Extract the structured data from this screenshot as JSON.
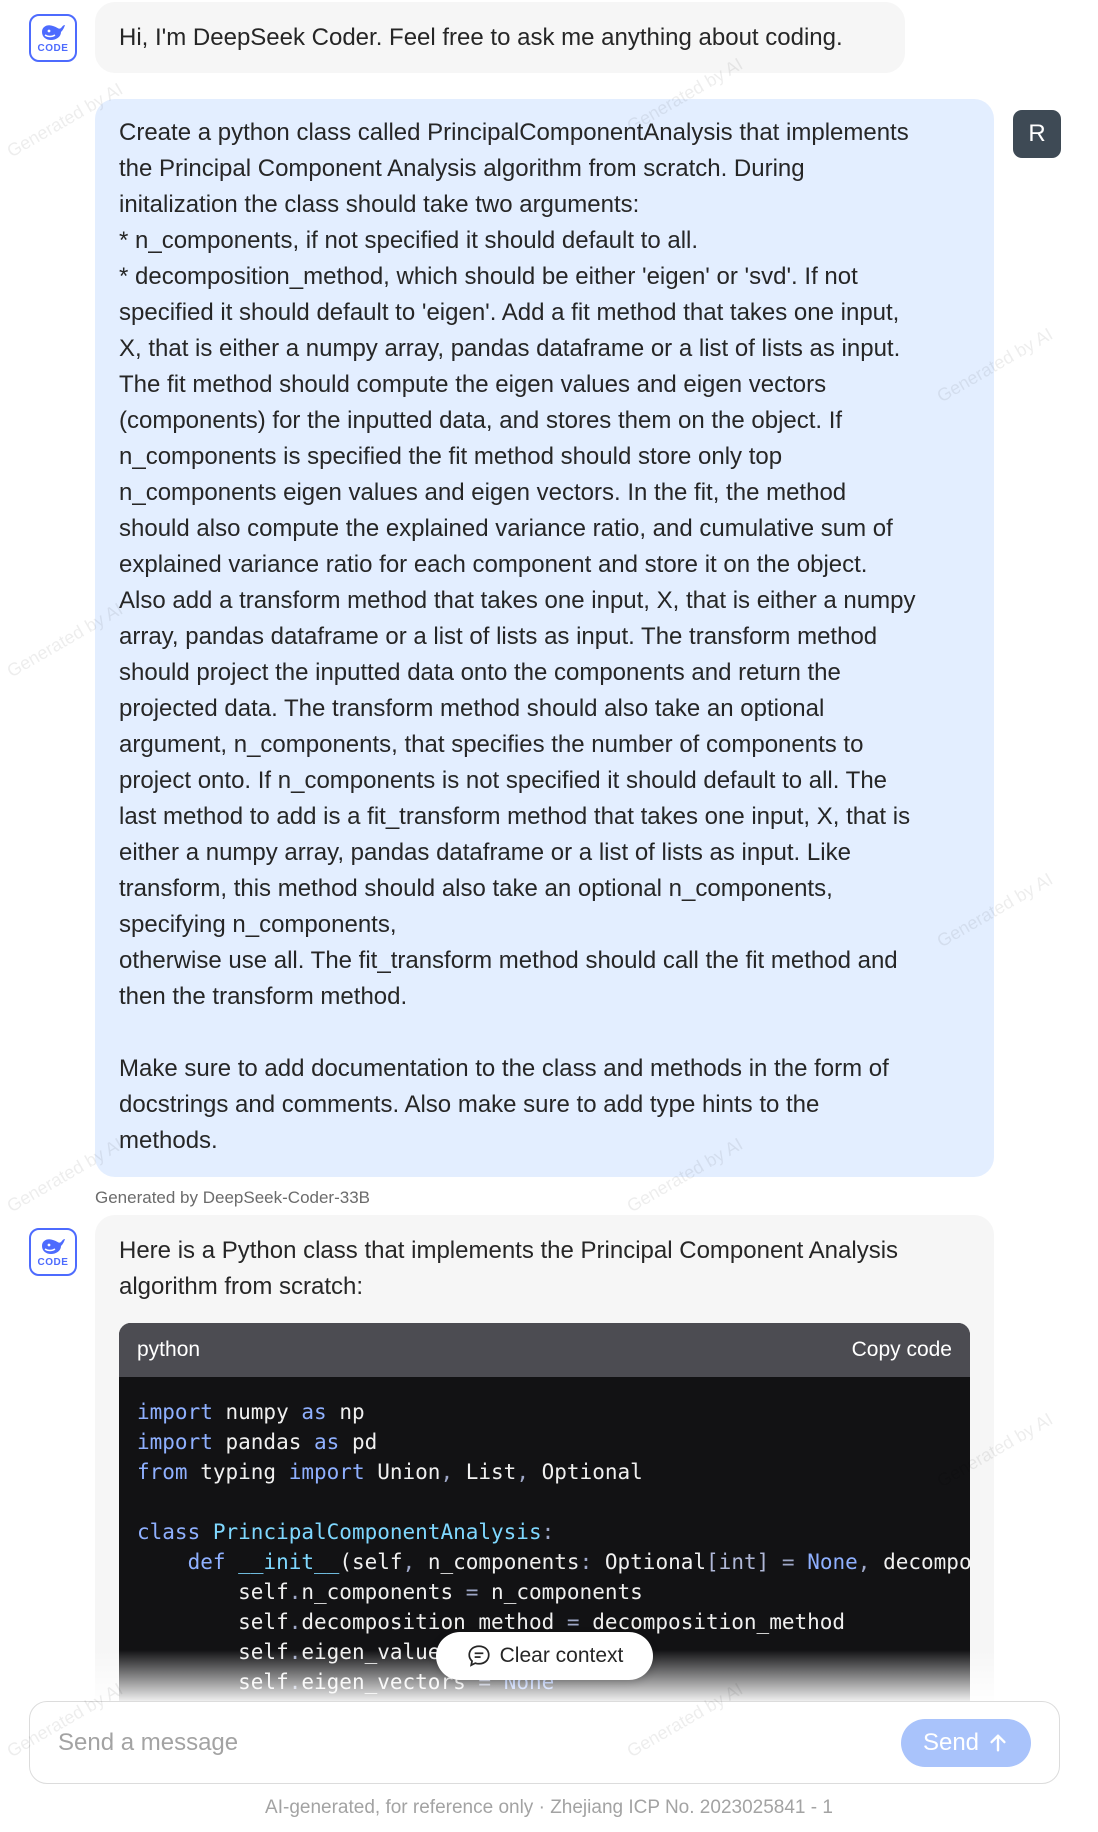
{
  "greeting": {
    "text": "Hi, I'm DeepSeek Coder. Feel free to ask me anything about coding.",
    "avatar_label": "CODE"
  },
  "user": {
    "avatar_initial": "R",
    "message_lines": [
      "Create a python class called PrincipalComponentAnalysis that implements",
      "the Principal Component Analysis algorithm from scratch.  During",
      "initalization the class should take two arguments:",
      "* n_components, if not specified it should default to all.",
      "* decomposition_method, which should be either 'eigen' or 'svd'. If not",
      "specified it should default to 'eigen'. Add a fit method that takes one input,",
      "X, that is either a numpy array, pandas dataframe or a list of lists as input.",
      "The fit method  should compute the eigen values and eigen vectors",
      "(components) for the inputted data, and stores them on the object. If",
      "n_components is specified the fit method should store only top",
      "n_components eigen values and eigen vectors. In the fit, the method",
      "should also compute the explained variance ratio, and cumulative sum of",
      "explained variance ratio for each component and store it on the object.",
      "Also add a transform method that takes one input, X, that is either a numpy",
      "array, pandas dataframe or a list of lists as input. The transform method",
      "should project the inputted data onto the components and return the",
      "projected data. The transform method should also take an optional",
      "argument, n_components, that specifies the number of components to",
      "project onto. If n_components is not specified it should default to all. The",
      "last method to add is a fit_transform method that takes one input, X, that is",
      "either a numpy array, pandas dataframe or a list of lists as input. Like",
      "transform, this method should also take an optional n_components,",
      "specifying n_components,",
      "otherwise use all. The fit_transform method should call the fit method and",
      "then the transform method.",
      "",
      "Make sure to add documentation to the class and methods in the form of",
      "docstrings and comments. Also make sure to add type hints to the",
      "methods."
    ]
  },
  "model_label": "Generated by DeepSeek-Coder-33B",
  "bot": {
    "avatar_label": "CODE",
    "intro_lines": [
      "Here is a Python class that implements the Principal Component Analysis",
      "algorithm from scratch:"
    ],
    "code": {
      "language": "python",
      "copy_label": "Copy code"
    }
  },
  "clear_context_label": "Clear context",
  "composer": {
    "placeholder": "Send a message",
    "send_label": "Send"
  },
  "footer": "AI-generated, for reference only  · Zhejiang ICP No. 2023025841 - 1",
  "watermark": "Generated by AI",
  "colors": {
    "accent": "#4d6bfe",
    "user_bubble": "#e3eeff",
    "bot_bubble": "#f6f6f6",
    "send_button": "#a9c3fb",
    "code_bg": "#121214",
    "code_header": "#4c4c52"
  },
  "icons": [
    "deepseek-whale-icon",
    "chat-bubble-icon",
    "arrow-up-icon"
  ]
}
